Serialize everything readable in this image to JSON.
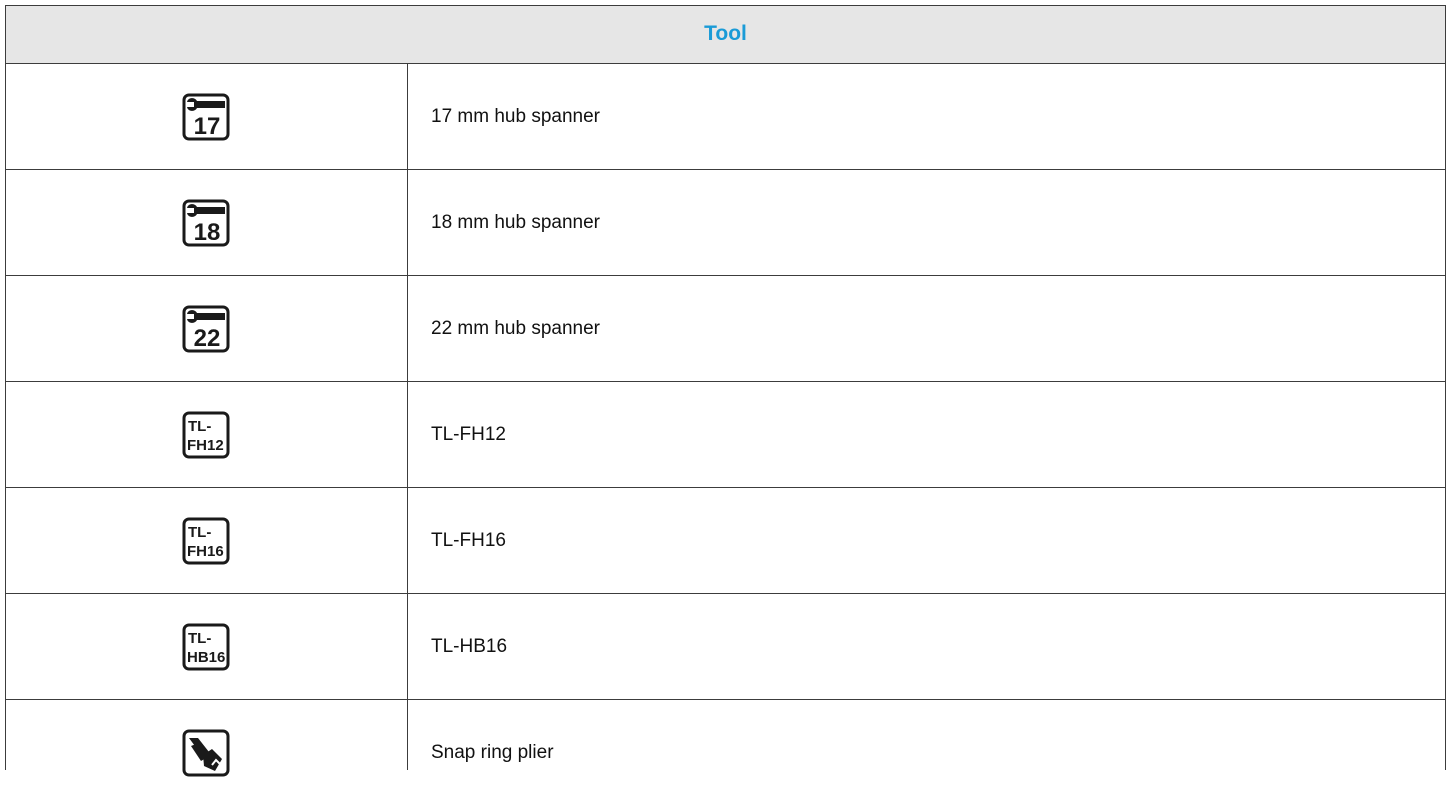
{
  "table": {
    "header": "Tool",
    "accent_color": "#1a9bd7",
    "rows": [
      {
        "icon": "spanner-17-icon",
        "icon_text": "17",
        "name": "17 mm hub spanner"
      },
      {
        "icon": "spanner-18-icon",
        "icon_text": "18",
        "name": "18 mm hub spanner"
      },
      {
        "icon": "spanner-22-icon",
        "icon_text": "22",
        "name": "22 mm hub spanner"
      },
      {
        "icon": "tl-fh12-icon",
        "icon_text": [
          "TL-",
          "FH12"
        ],
        "name": "TL-FH12"
      },
      {
        "icon": "tl-fh16-icon",
        "icon_text": [
          "TL-",
          "FH16"
        ],
        "name": "TL-FH16"
      },
      {
        "icon": "tl-hb16-icon",
        "icon_text": [
          "TL-",
          "HB16"
        ],
        "name": "TL-HB16"
      },
      {
        "icon": "snap-ring-plier-icon",
        "name": "Snap ring plier"
      }
    ]
  }
}
